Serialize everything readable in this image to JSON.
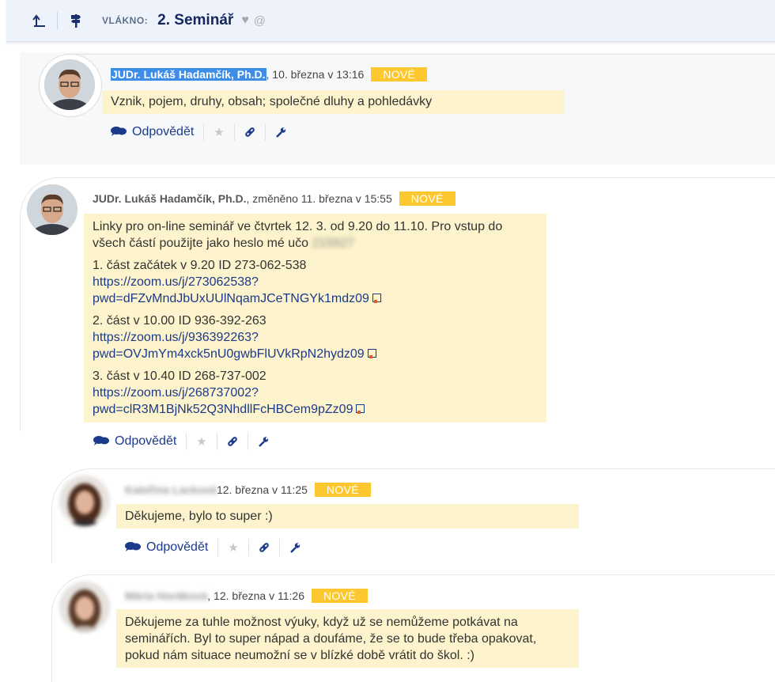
{
  "header": {
    "thread_label": "VLÁKNO:",
    "thread_title": "2. Seminář",
    "icons": [
      "up-arrow-icon",
      "signpost-icon",
      "heart-icon",
      "at-icon"
    ]
  },
  "posts": [
    {
      "author": "JUDr. Lukáš Hadamčík, Ph.D.",
      "date": ", 10. března v 13:16",
      "badge": "NOVÉ",
      "paragraphs": [
        "Vznik, pojem, druhy, obsah; společné dluhy a pohledávky"
      ],
      "reply_label": "Odpovědět"
    },
    {
      "author": "JUDr. Lukáš Hadamčík, Ph.D.",
      "date": ", změněno 11. března v 15:55",
      "badge": "NOVÉ",
      "intro": "Linky pro on-line seminář ve čtvrtek 12. 3. od 9.20 do 11.10. Pro vstup do všech částí použijte jako heslo mé učo",
      "intro_blurred": "215927",
      "parts": [
        {
          "title": "1. část začátek v 9.20 ID 273-062-538",
          "link1": "https://zoom.us/j/273062538?",
          "link2": "pwd=dFZvMndJbUxUUlNqamJCeTNGYk1mdz09"
        },
        {
          "title": "2. část v 10.00 ID 936-392-263",
          "link1": "https://zoom.us/j/936392263?",
          "link2": "pwd=OVJmYm4xck5nU0gwbFlUVkRpN2hydz09"
        },
        {
          "title": "3. část v 10.40 ID 268-737-002",
          "link1": "https://zoom.us/j/268737002?",
          "link2": "pwd=clR3M1BjNk52Q3NhdllFcHBCem9pZz09"
        }
      ],
      "reply_label": "Odpovědět"
    },
    {
      "author": "Kateřina Lacková",
      "date": "12. března v 11:25",
      "badge": "NOVÉ",
      "paragraphs": [
        "Děkujeme, bylo to super :)"
      ],
      "reply_label": "Odpovědět"
    },
    {
      "author": "Mária Horáková",
      "date": ", 12. března v 11:26",
      "badge": "NOVÉ",
      "paragraphs": [
        "Děkujeme za tuhle možnost výuky, když už se nemůžeme potkávat na seminářích. Byl to super nápad a doufáme, že se to bude třeba opakovat, pokud nám situace neumožní se v blízké době vrátit do škol. :)"
      ]
    }
  ]
}
